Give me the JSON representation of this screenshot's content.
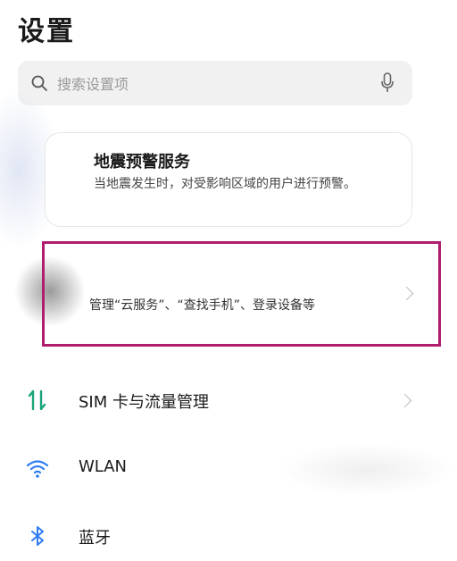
{
  "header": {
    "title": "设置"
  },
  "search": {
    "placeholder": "搜索设置项"
  },
  "earthquake_card": {
    "title": "地震预警服务",
    "description": "当地震发生时，对受影响区域的用户进行预警。"
  },
  "account_item": {
    "subtitle": "管理“云服务”、“查找手机”、登录设备等"
  },
  "settings_list": [
    {
      "label": "SIM 卡与流量管理",
      "icon": "sim-traffic-icon"
    },
    {
      "label": "WLAN",
      "icon": "wifi-icon"
    },
    {
      "label": "蓝牙",
      "icon": "bluetooth-icon"
    }
  ],
  "colors": {
    "highlight": "#b01d6f",
    "sim_icon": "#1aa37a",
    "wifi_icon": "#2f7bf5",
    "bluetooth_icon": "#2f7bf5"
  }
}
